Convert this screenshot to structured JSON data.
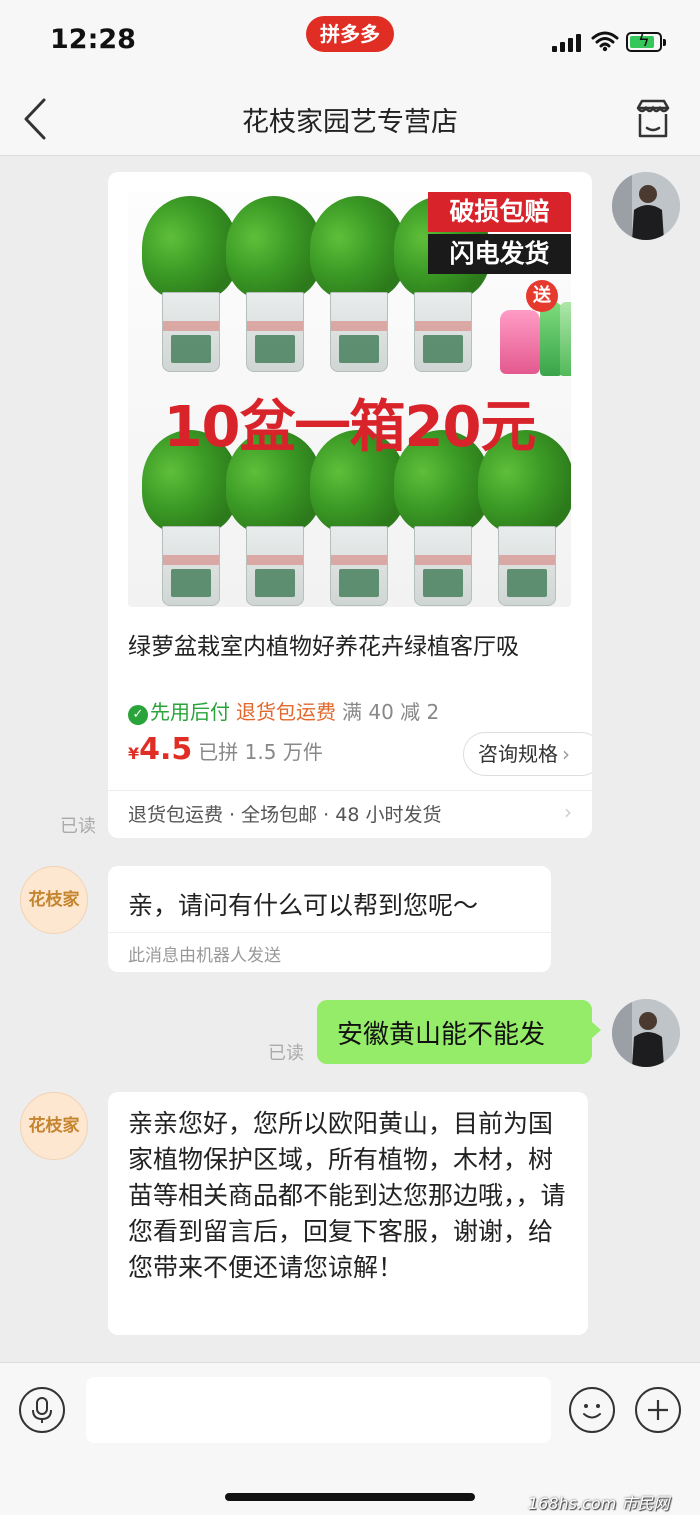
{
  "status_bar": {
    "time": "12:28",
    "app_badge": "拼多多"
  },
  "header": {
    "title": "花枝家园艺专营店"
  },
  "product_card": {
    "image": {
      "banner_top": "破损包赔",
      "banner_bottom": "闪电发货",
      "gift_label": "送",
      "headline": "10盆一箱20元"
    },
    "title": "绿萝盆栽室内植物好养花卉绿植客厅吸",
    "tags": {
      "pay_later": "先用后付",
      "return_shipping": "退货包运费",
      "discount": "满 40 减 2"
    },
    "price_symbol": "¥",
    "price": "4.5",
    "sold": "已拼 1.5 万件",
    "consult_button": "咨询规格",
    "footer": "退货包运费 · 全场包邮 · 48 小时发货"
  },
  "messages": {
    "read_label": "已读",
    "shop_avatar_text": "花枝家",
    "bot_text": "亲，请问有什么可以帮到您呢～",
    "bot_note": "此消息由机器人发送",
    "user_text": "安徽黄山能不能发",
    "reply_text": "亲亲您好，您所以欧阳黄山，目前为国家植物保护区域，所有植物，木材，树苗等相关商品都不能到达您那边哦，，请您看到留言后，回复下客服，谢谢，给您带来不便还请您谅解！"
  },
  "input": {
    "placeholder": ""
  },
  "watermark": "168hs.com 市民网",
  "colors": {
    "accent_red": "#e02e24",
    "user_bubble": "#95ec69",
    "green_tag": "#2aa43a",
    "orange_tag": "#e2682d"
  }
}
